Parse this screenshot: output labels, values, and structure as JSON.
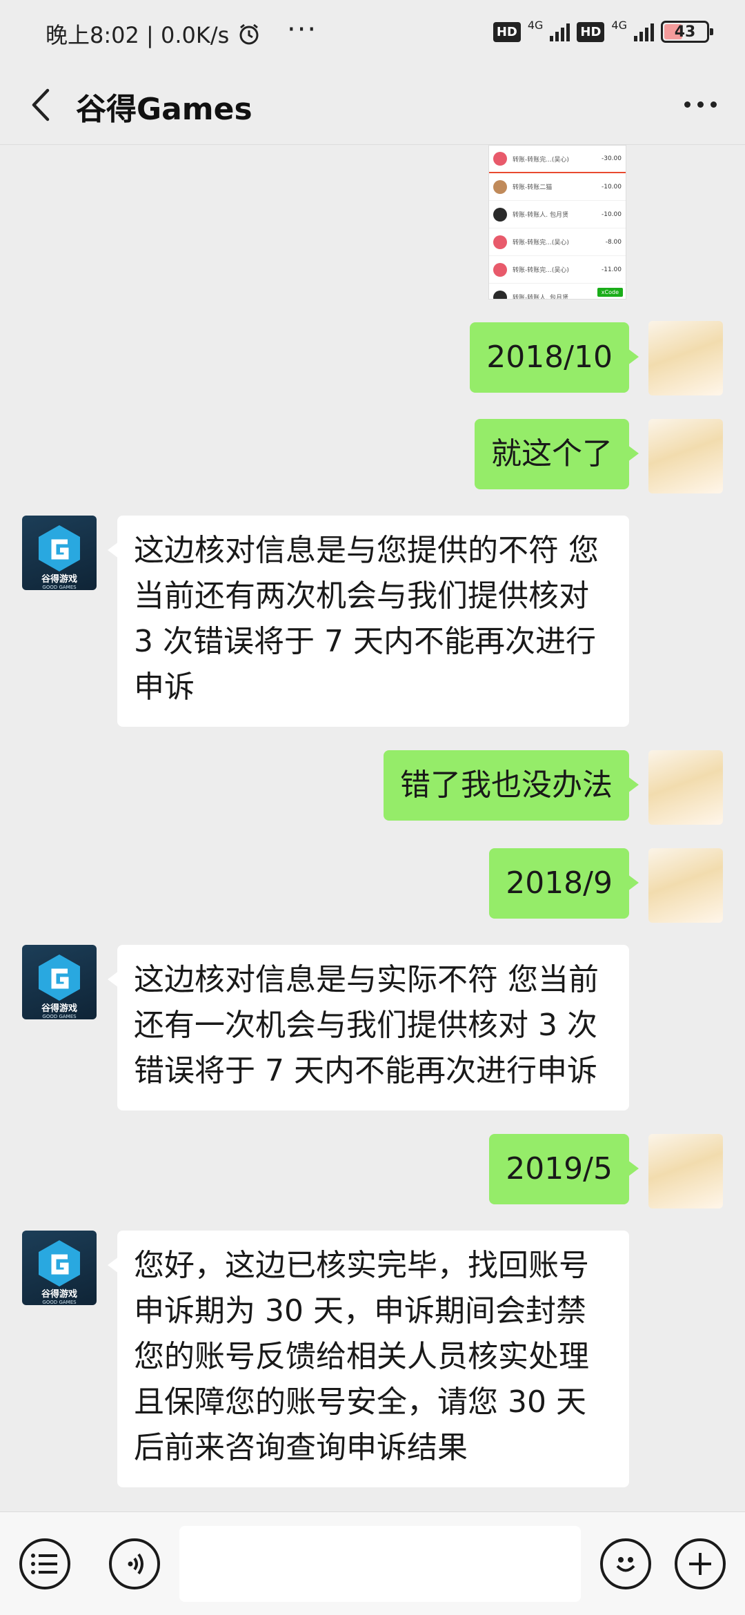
{
  "status_bar": {
    "time_speed": "晚上8:02 | 0.0K/s",
    "dots": "···",
    "hd1": "HD",
    "net1": "4G",
    "hd2": "HD",
    "net2": "4G",
    "battery": "43"
  },
  "header": {
    "title": "谷得Games"
  },
  "shared_image": {
    "rows": [
      {
        "text": "转账-转账完...(吴心)",
        "amount": "-30.00"
      },
      {
        "text": "转账-转账二猫",
        "amount": "-10.00"
      },
      {
        "text": "转账-转账人. 包月贤",
        "amount": "-10.00"
      },
      {
        "text": "转账-转账完...(吴心)",
        "amount": "-8.00"
      },
      {
        "text": "转账-转账完...(吴心)",
        "amount": "-11.00"
      },
      {
        "text": "转账-转账人. 包月贤",
        "amount": ""
      }
    ],
    "button": "xCode"
  },
  "messages": [
    {
      "side": "out",
      "text": "2018/10"
    },
    {
      "side": "out",
      "text": "就这个了"
    },
    {
      "side": "in",
      "text": "这边核对信息是与您提供的不符 您当前还有两次机会与我们提供核对 3 次错误将于 7 天内不能再次进行申诉"
    },
    {
      "side": "out",
      "text": "错了我也没办法"
    },
    {
      "side": "out",
      "text": "2018/9"
    },
    {
      "side": "in",
      "text": "这边核对信息是与实际不符 您当前还有一次机会与我们提供核对 3 次错误将于 7 天内不能再次进行申诉"
    },
    {
      "side": "out",
      "text": "2019/5"
    },
    {
      "side": "in",
      "text": "您好，这边已核实完毕，找回账号申诉期为 30 天，申诉期间会封禁您的账号反馈给相关人员核实处理且保障您的账号安全，请您 30 天后前来咨询查询申诉结果"
    }
  ],
  "brand_avatar": {
    "cn": "谷得游戏",
    "en": "GOOD GAMES"
  },
  "colors": {
    "outgoing_bubble": "#95ec69",
    "incoming_bubble": "#ffffff",
    "background": "#ededed"
  },
  "input_bar": {
    "icons": [
      "list-icon",
      "voice-icon",
      "emoji-icon",
      "plus-icon"
    ],
    "placeholder": ""
  }
}
